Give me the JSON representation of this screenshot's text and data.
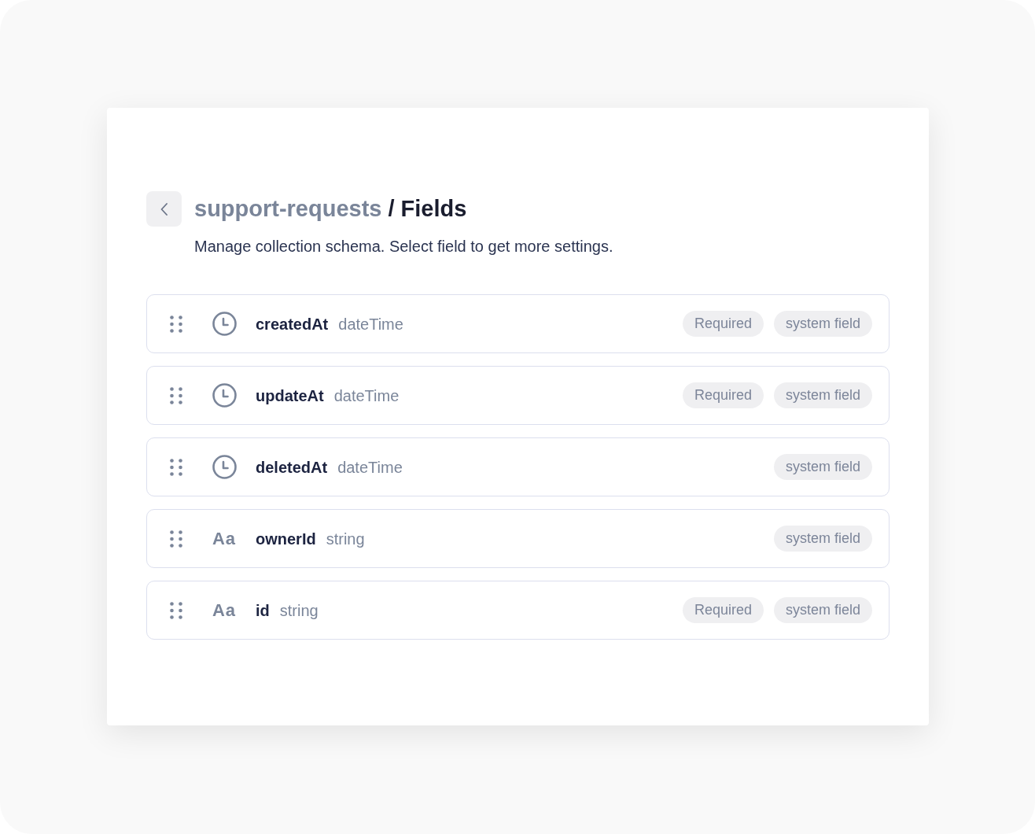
{
  "header": {
    "parent": "support-requests",
    "separator": "/",
    "title": "Fields",
    "subtitle": "Manage collection schema. Select field to get more settings."
  },
  "fields": [
    {
      "kind": "datetime",
      "name": "createdAt",
      "type": "dateTime",
      "badges": [
        "Required",
        "system field"
      ]
    },
    {
      "kind": "datetime",
      "name": "updateAt",
      "type": "dateTime",
      "badges": [
        "Required",
        "system field"
      ]
    },
    {
      "kind": "datetime",
      "name": "deletedAt",
      "type": "dateTime",
      "badges": [
        "system field"
      ]
    },
    {
      "kind": "string",
      "type_icon": "Aa",
      "name": "ownerId",
      "type": "string",
      "badges": [
        "system field"
      ]
    },
    {
      "kind": "string",
      "type_icon": "Aa",
      "name": "id",
      "type": "string",
      "badges": [
        "Required",
        "system field"
      ]
    }
  ]
}
